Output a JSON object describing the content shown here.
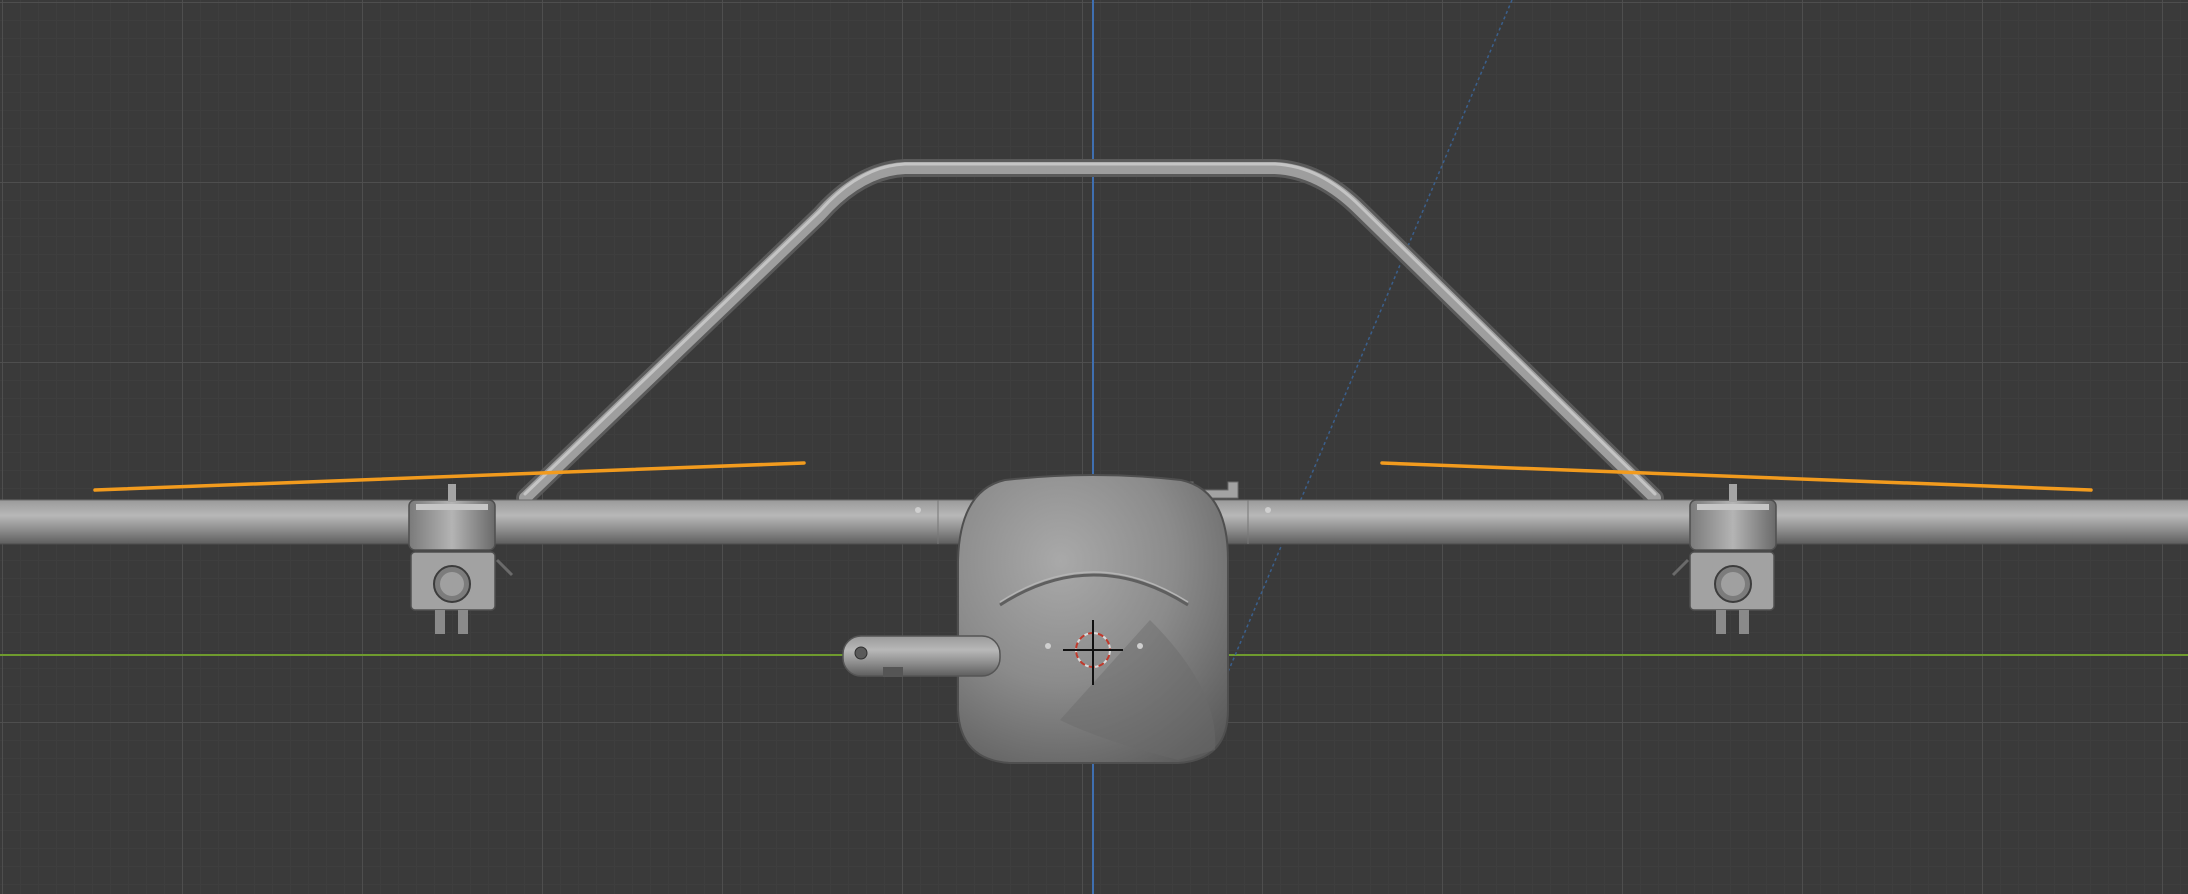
{
  "app": "3D viewport",
  "viewport": {
    "view": "front-orthographic",
    "grid": true,
    "background": "#3a3a3a",
    "grid_line_color": "#4c4c4c",
    "x_axis_color": "#6f9b2e",
    "z_axis_color": "#3f6fb0",
    "selection_color": "#f29b1e"
  },
  "model": {
    "name": "drone",
    "parts": [
      "fuselage",
      "wing",
      "top-frame",
      "left-motor",
      "right-motor",
      "left-propeller",
      "right-propeller",
      "camera-mount"
    ],
    "selected_parts": [
      "left-propeller",
      "right-propeller"
    ]
  },
  "cursor": {
    "icon": "3d-cursor-icon"
  }
}
